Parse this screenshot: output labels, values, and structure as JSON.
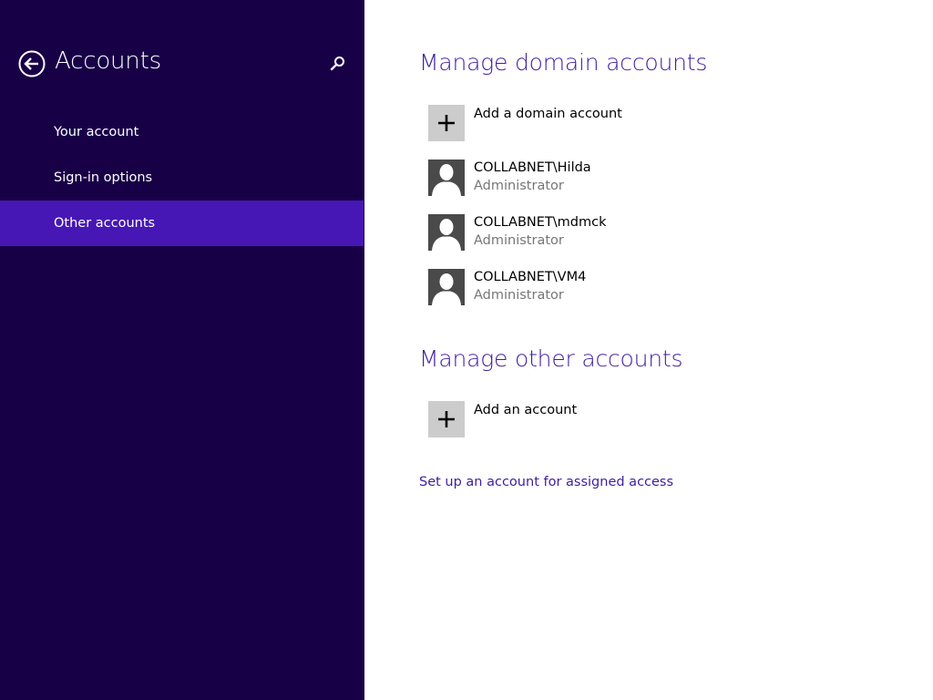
{
  "sidebar": {
    "title": "Accounts",
    "back_icon": "back-arrow-icon",
    "search_icon": "search-icon",
    "items": [
      {
        "label": "Your account",
        "selected": false
      },
      {
        "label": "Sign-in options",
        "selected": false
      },
      {
        "label": "Other accounts",
        "selected": true
      }
    ]
  },
  "main": {
    "domain_section": {
      "title": "Manage domain accounts",
      "add_label": "Add a domain account",
      "accounts": [
        {
          "name": "COLLABNET\\Hilda",
          "role": "Administrator"
        },
        {
          "name": "COLLABNET\\mdmck",
          "role": "Administrator"
        },
        {
          "name": "COLLABNET\\VM4",
          "role": "Administrator"
        }
      ]
    },
    "other_section": {
      "title": "Manage other accounts",
      "add_label": "Add an account"
    },
    "assigned_access_link": "Set up an account for assigned access"
  },
  "colors": {
    "sidebar_bg": "#180047",
    "selected_bg": "#4617b4",
    "accent_text": "#3f1ea0",
    "secondary_text": "#767676",
    "tile_add_bg": "#cccccc",
    "tile_user_bg": "#4a4a4a"
  }
}
